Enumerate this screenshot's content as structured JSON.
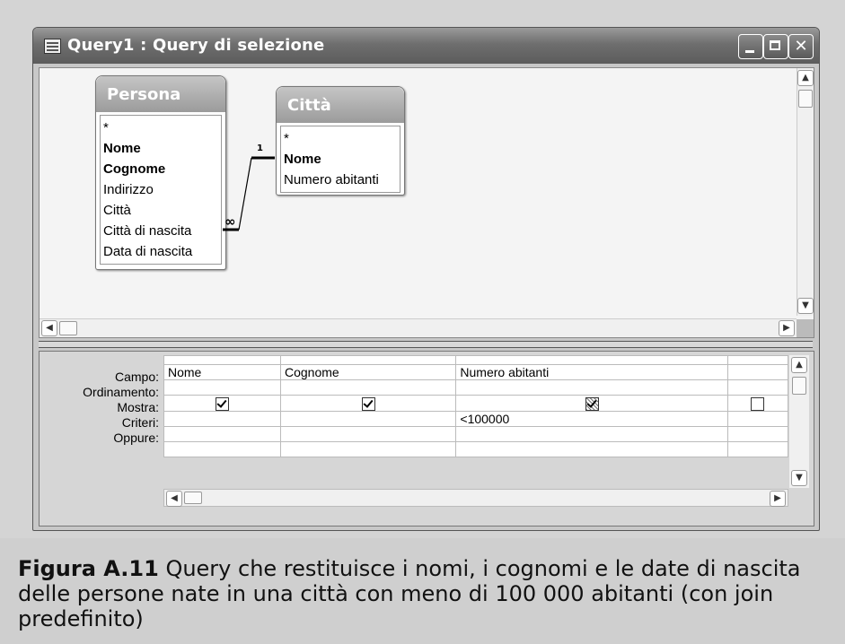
{
  "window": {
    "title": "Query1 : Query di selezione"
  },
  "tables": [
    {
      "name": "Persona",
      "fields": [
        "*",
        "Nome",
        "Cognome",
        "Indirizzo",
        "Città",
        "Città di nascita",
        "Data di nascita"
      ],
      "key_fields": [
        "Nome",
        "Cognome"
      ]
    },
    {
      "name": "Città",
      "fields": [
        "*",
        "Nome",
        "Numero abitanti"
      ],
      "key_fields": [
        "Nome"
      ]
    }
  ],
  "join": {
    "one_label": "1",
    "many_label": "∞"
  },
  "grid": {
    "row_labels": [
      "Campo:",
      "Ordinamento:",
      "Mostra:",
      "Criteri:",
      "Oppure:"
    ],
    "columns": [
      {
        "campo": "Nome",
        "ordinamento": "",
        "mostra": true,
        "criteri": "",
        "oppure": ""
      },
      {
        "campo": "Cognome",
        "ordinamento": "",
        "mostra": true,
        "criteri": "",
        "oppure": ""
      },
      {
        "campo": "Numero abitanti",
        "ordinamento": "",
        "mostra": "hatched",
        "criteri": "<100000",
        "oppure": ""
      },
      {
        "campo": "",
        "ordinamento": "",
        "mostra": false,
        "criteri": "",
        "oppure": ""
      }
    ]
  },
  "caption": {
    "label": "Figura A.11",
    "text": " Query che restituisce i nomi, i cognomi e le date di nascita delle persone nate in una città con meno di 100 000 abitanti (con join predefinito)"
  }
}
